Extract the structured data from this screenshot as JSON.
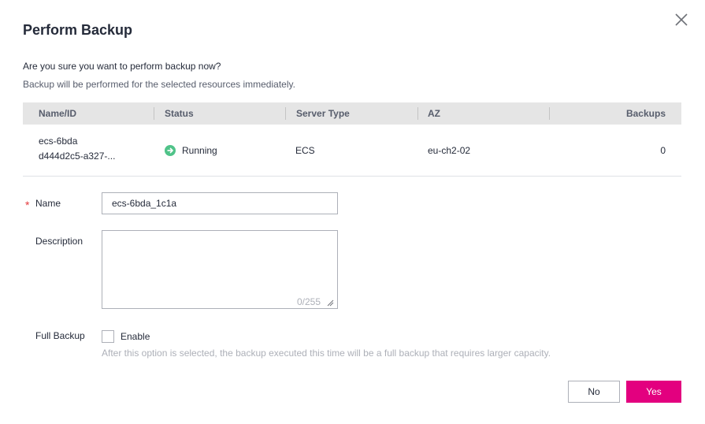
{
  "dialog": {
    "title": "Perform Backup",
    "confirm_text": "Are you sure you want to perform backup now?",
    "info_text": "Backup will be performed for the selected resources immediately."
  },
  "table": {
    "columns": [
      "Name/ID",
      "Status",
      "Server Type",
      "AZ",
      "Backups"
    ],
    "rows": [
      {
        "name": "ecs-6bda",
        "id": "d444d2c5-a327-...",
        "status": "Running",
        "server_type": "ECS",
        "az": "eu-ch2-02",
        "backups": "0"
      }
    ]
  },
  "form": {
    "name_label": "Name",
    "name_value": "ecs-6bda_1c1a",
    "description_label": "Description",
    "description_value": "",
    "description_counter": "0/255",
    "full_backup_label": "Full Backup",
    "enable_label": "Enable",
    "full_backup_checked": false,
    "full_backup_hint": "After this option is selected, the backup executed this time will be a full backup that requires larger capacity."
  },
  "buttons": {
    "no_label": "No",
    "yes_label": "Yes"
  },
  "colors": {
    "primary": "#e3007f",
    "status_running": "#50c389",
    "required": "#e4393c"
  },
  "icons": {
    "close": "close-icon",
    "status": "running-status-icon"
  }
}
